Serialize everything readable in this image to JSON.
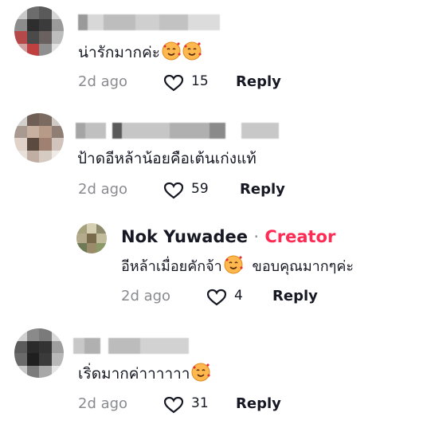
{
  "comments": [
    {
      "text": "น่ารักมากค่ะ",
      "emojis": [
        "smiling-face-with-hearts",
        "smiling-face-with-hearts"
      ],
      "time": "2d ago",
      "likes": "15",
      "reply_label": "Reply"
    },
    {
      "text": "ป้าดอีหล้าน้อยคือเต้นเก่งแท้",
      "time": "2d ago",
      "likes": "59",
      "reply_label": "Reply",
      "reply": {
        "author": "Nok Yuwadee",
        "separator": "·",
        "badge": "Creator",
        "text_before": "อีหล้าเมื่อยคักจ้า",
        "text_after": "ขอบคุณมากๆค่ะ",
        "time": "2d ago",
        "likes": "4",
        "reply_label": "Reply"
      }
    },
    {
      "text": "เริ่ดมากค่าาาาาา",
      "time": "2d ago",
      "likes": "31",
      "reply_label": "Reply"
    }
  ],
  "colors": {
    "accent": "#fe2c55",
    "muted": "#8a8b91",
    "text": "#161823"
  }
}
